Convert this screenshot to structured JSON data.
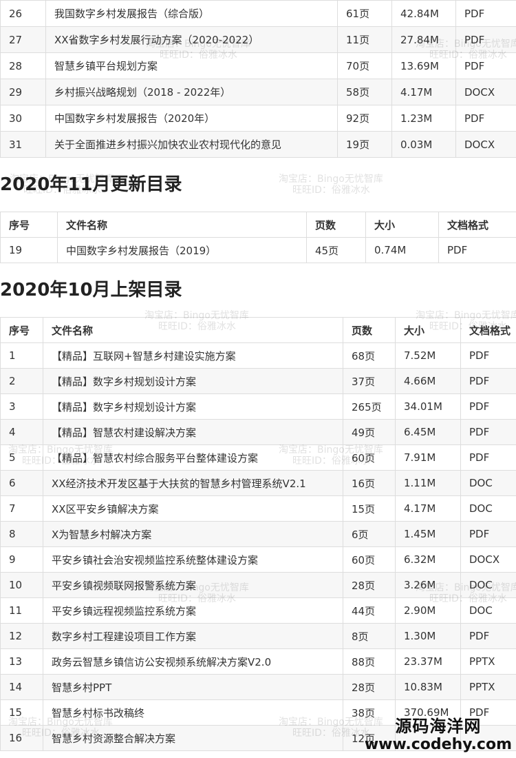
{
  "top_rows": [
    [
      "26",
      "我国数字乡村发展报告（综合版）",
      "61页",
      "42.84M",
      "PDF"
    ],
    [
      "27",
      "XX省数字乡村发展行动方案（2020-2022）",
      "11页",
      "27.84M",
      "PDF"
    ],
    [
      "28",
      "智慧乡镇平台规划方案",
      "70页",
      "13.69M",
      "PDF"
    ],
    [
      "29",
      "乡村振兴战略规划（2018 - 2022年）",
      "58页",
      "4.17M",
      "DOCX"
    ],
    [
      "30",
      "中国数字乡村发展报告（2020年）",
      "92页",
      "1.23M",
      "PDF"
    ],
    [
      "31",
      "关于全面推进乡村振兴加快农业农村现代化的意见",
      "19页",
      "0.03M",
      "DOCX"
    ]
  ],
  "section_nov": {
    "title": "2020年11月更新目录",
    "headers": [
      "序号",
      "文件名称",
      "页数",
      "大小",
      "文档格式"
    ],
    "rows": [
      [
        "19",
        "中国数字乡村发展报告（2019）",
        "45页",
        "0.74M",
        "PDF"
      ]
    ]
  },
  "section_oct": {
    "title": "2020年10月上架目录",
    "headers": [
      "序号",
      "文件名称",
      "页数",
      "大小",
      "文档格式"
    ],
    "rows": [
      [
        "1",
        "【精品】互联网+智慧乡村建设实施方案",
        "68页",
        "7.52M",
        "PDF"
      ],
      [
        "2",
        "【精品】数字乡村规划设计方案",
        "37页",
        "4.66M",
        "PDF"
      ],
      [
        "3",
        "【精品】数字乡村规划设计方案",
        "265页",
        "34.01M",
        "PDF"
      ],
      [
        "4",
        "【精品】智慧农村建设解决方案",
        "49页",
        "6.45M",
        "PDF"
      ],
      [
        "5",
        "【精品】智慧农村综合服务平台整体建设方案",
        "60页",
        "7.91M",
        "PDF"
      ],
      [
        "6",
        "XX经济技术开发区基于大扶贫的智慧乡村管理系统V2.1",
        "16页",
        "1.11M",
        "DOC"
      ],
      [
        "7",
        "XX区平安乡镇解决方案",
        "15页",
        "4.17M",
        "DOC"
      ],
      [
        "8",
        "X为智慧乡村解决方案",
        "6页",
        "1.45M",
        "PDF"
      ],
      [
        "9",
        "平安乡镇社会治安视频监控系统整体建设方案",
        "60页",
        "6.32M",
        "DOCX"
      ],
      [
        "10",
        "平安乡镇视频联网报警系统方案",
        "28页",
        "3.26M",
        "DOC"
      ],
      [
        "11",
        "平安乡镇远程视频监控系统方案",
        "44页",
        "2.90M",
        "DOC"
      ],
      [
        "12",
        "数字乡村工程建设项目工作方案",
        "8页",
        "1.30M",
        "PDF"
      ],
      [
        "13",
        "政务云智慧乡镇信访公安视频系统解决方案V2.0",
        "88页",
        "23.37M",
        "PPTX"
      ],
      [
        "14",
        "智慧乡村PPT",
        "28页",
        "10.83M",
        "PPTX"
      ],
      [
        "15",
        "智慧乡村标书改稿终",
        "38页",
        "370.69M",
        "PDF"
      ],
      [
        "16",
        "智慧乡村资源整合解决方案",
        "12页",
        "",
        ""
      ]
    ]
  },
  "watermark": {
    "line1": "淘宝店：Bingo无忧智库",
    "line2": "旺旺ID：俗雅冰水"
  },
  "brand": {
    "name": "源码海洋网",
    "url": "www.codehy.com"
  }
}
